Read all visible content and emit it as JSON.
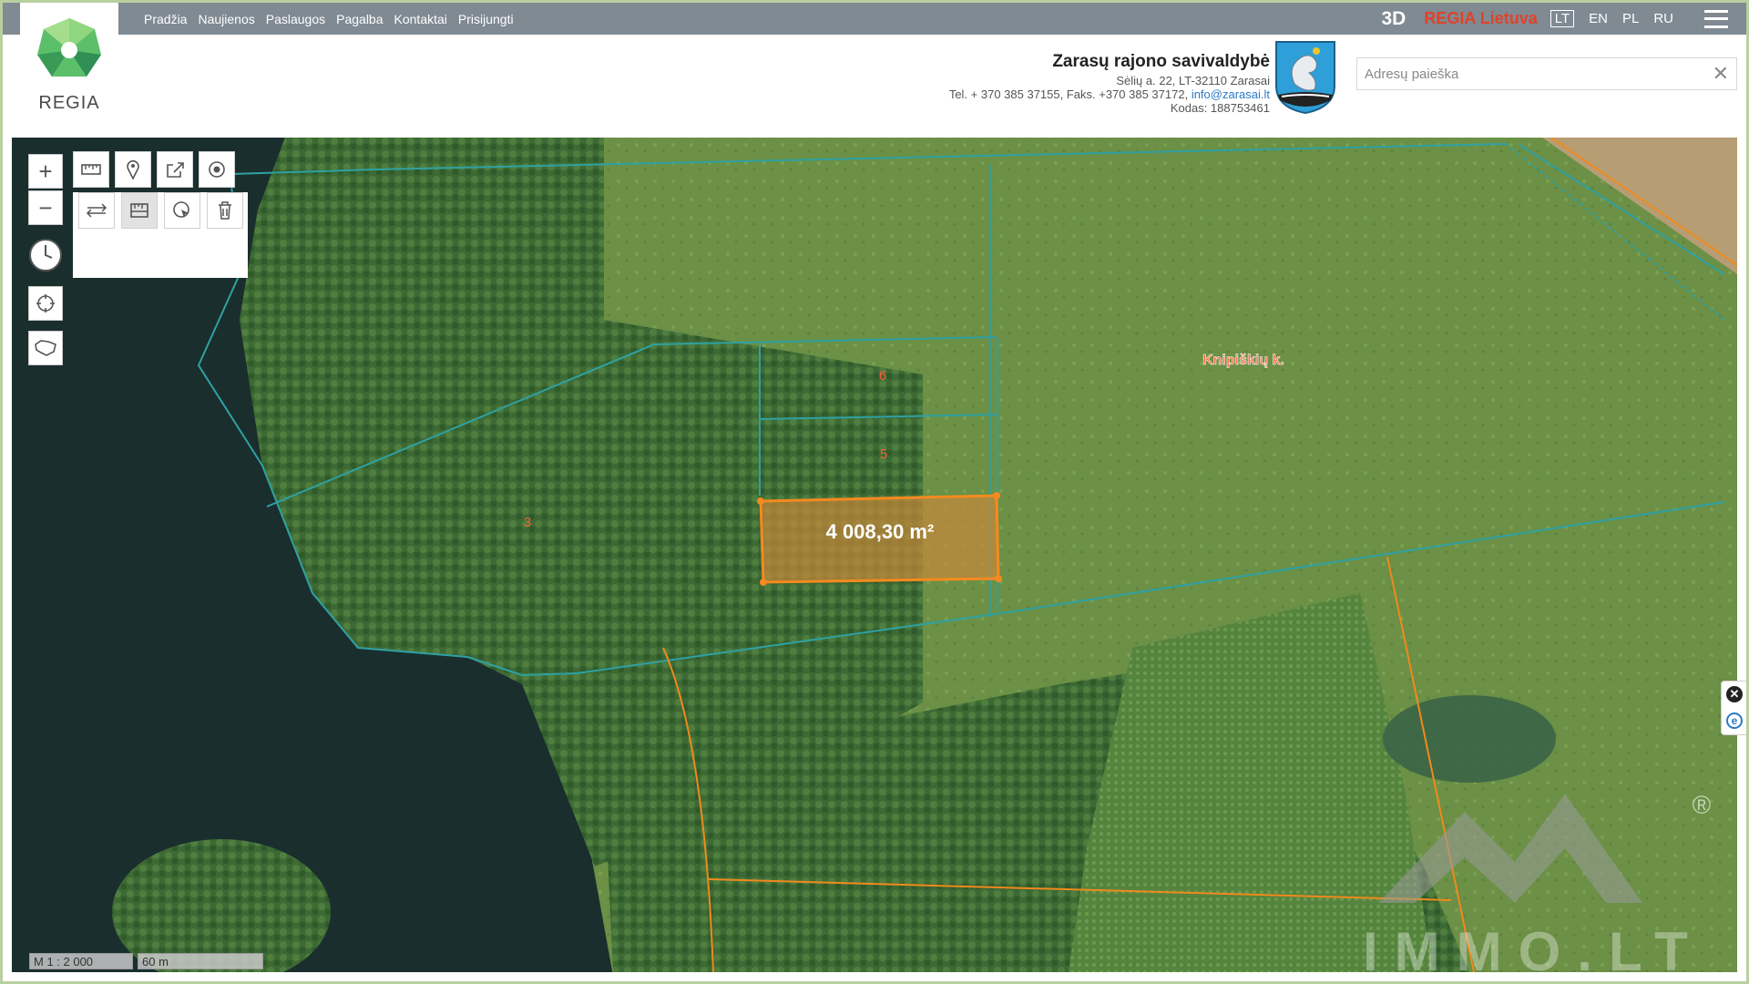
{
  "header": {
    "logo_text": "REGIA",
    "nav": [
      "Pradžia",
      "Naujienos",
      "Paslaugos",
      "Pagalba",
      "Kontaktai",
      "Prisijungti"
    ],
    "btn_3d": "3D",
    "regia_lt": "REGIA Lietuva",
    "languages": [
      "LT",
      "EN",
      "PL",
      "RU"
    ],
    "active_language": "LT"
  },
  "municipality": {
    "name": "Zarasų rajono savivaldybė",
    "address": "Sėlių a. 22, LT-32110 Zarasai",
    "phone": "Tel. + 370 385 37155, Faks. +370 385 37172, ",
    "email": "info@zarasai.lt",
    "code": "Kodas: 188753461"
  },
  "search": {
    "placeholder": "Adresų paieška",
    "clear_icon": "close-icon"
  },
  "map": {
    "parcel_numbers": [
      "6",
      "5",
      "3"
    ],
    "village_label": "Knipiškių k.",
    "measured_area": "4 008,30 m²",
    "scale_ratio": "M 1 : 2 000",
    "scale_bar": "60 m",
    "watermark": "IMMO.LT",
    "watermark_mark": "®",
    "colors": {
      "parcel_line": "#2fa1a3",
      "boundary_line": "#f08a1c",
      "measure_fill": "#c8893a",
      "label_red": "#ff5a3c"
    }
  },
  "controls": {
    "zoom_in_icon": "plus-icon",
    "zoom_out_icon": "minus-icon",
    "history_icon": "clock-icon",
    "locate_icon": "crosshair-icon",
    "lithuania_icon": "lithuania-map-icon",
    "tools_top": [
      "measure-ruler-icon",
      "marker-icon",
      "share-icon",
      "target-icon"
    ],
    "tools_sub": [
      "distance-icon",
      "area-icon",
      "query-icon",
      "trash-icon"
    ]
  }
}
